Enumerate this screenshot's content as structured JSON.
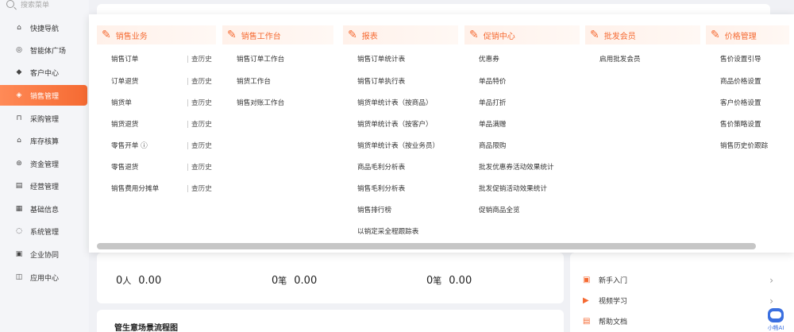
{
  "sidebar": {
    "search_placeholder": "搜索菜单",
    "items": [
      {
        "label": "快捷导航",
        "icon": "home-icon",
        "glyph": "⌂"
      },
      {
        "label": "智能体广场",
        "icon": "agent-icon",
        "glyph": "◎"
      },
      {
        "label": "客户中心",
        "icon": "diamond-icon",
        "glyph": "◆"
      },
      {
        "label": "销售管理",
        "icon": "sales-icon",
        "glyph": "◈"
      },
      {
        "label": "采购管理",
        "icon": "bag-icon",
        "glyph": "⊓"
      },
      {
        "label": "库存核算",
        "icon": "warehouse-icon",
        "glyph": "⌂"
      },
      {
        "label": "资金管理",
        "icon": "money-icon",
        "glyph": "⊛"
      },
      {
        "label": "经营管理",
        "icon": "document-icon",
        "glyph": "▤"
      },
      {
        "label": "基础信息",
        "icon": "grid-icon",
        "glyph": "▦"
      },
      {
        "label": "系统管理",
        "icon": "settings-icon",
        "glyph": "◌"
      },
      {
        "label": "企业协同",
        "icon": "calendar-icon",
        "glyph": "▣"
      },
      {
        "label": "应用中心",
        "icon": "app-icon",
        "glyph": "◫"
      }
    ],
    "active_index": 3,
    "active_color": "#f56a32"
  },
  "menu": {
    "columns": [
      {
        "title": "销售业务",
        "icon": "sales-business-icon",
        "items": [
          "销售订单",
          "订单退货",
          "销货单",
          "销货退货",
          "零售开单 ⓘ",
          "零售退货",
          "销售费用分摊单"
        ],
        "history_label": "查历史"
      },
      {
        "title": "销售工作台",
        "icon": "sales-workbench-icon",
        "items": [
          "销售订单工作台",
          "销货工作台",
          "销售对账工作台"
        ]
      },
      {
        "title": "报表",
        "icon": "report-icon",
        "items": [
          "销售订单统计表",
          "销售订单执行表",
          "销货单统计表（按商品）",
          "销货单统计表（按客户）",
          "销货单统计表（按业务员）",
          "商品毛利分析表",
          "销售毛利分析表",
          "销售排行榜",
          "以销定采全程跟踪表"
        ]
      },
      {
        "title": "促销中心",
        "icon": "promotion-icon",
        "items": [
          "优惠券",
          "单品特价",
          "单品打折",
          "单品满赠",
          "商品限购",
          "批发优惠券活动效果统计",
          "批发促销活动效果统计",
          "促销商品全览"
        ]
      },
      {
        "title": "批发会员",
        "icon": "wholesale-member-icon",
        "items": [
          "启用批发会员"
        ]
      },
      {
        "title": "价格管理",
        "icon": "price-icon",
        "items": [
          "售价设置引导",
          "商品价格设置",
          "客户价格设置",
          "售价策略设置",
          "销售历史价跟踪"
        ]
      }
    ]
  },
  "stats": [
    {
      "count": "0",
      "unit": "人",
      "value": "0.00"
    },
    {
      "count": "0",
      "unit": "笔",
      "value": "0.00"
    },
    {
      "count": "0",
      "unit": "笔",
      "value": "0.00"
    }
  ],
  "flow": {
    "title": "管生意场景流程图"
  },
  "help": {
    "items": [
      {
        "label": "新手入门",
        "icon": "book-icon",
        "glyph": "▣"
      },
      {
        "label": "视频学习",
        "icon": "play-icon",
        "glyph": "▶"
      },
      {
        "label": "帮助文档",
        "icon": "doc-icon",
        "glyph": "▤"
      }
    ]
  },
  "assistant": {
    "label": "小畅AI"
  }
}
